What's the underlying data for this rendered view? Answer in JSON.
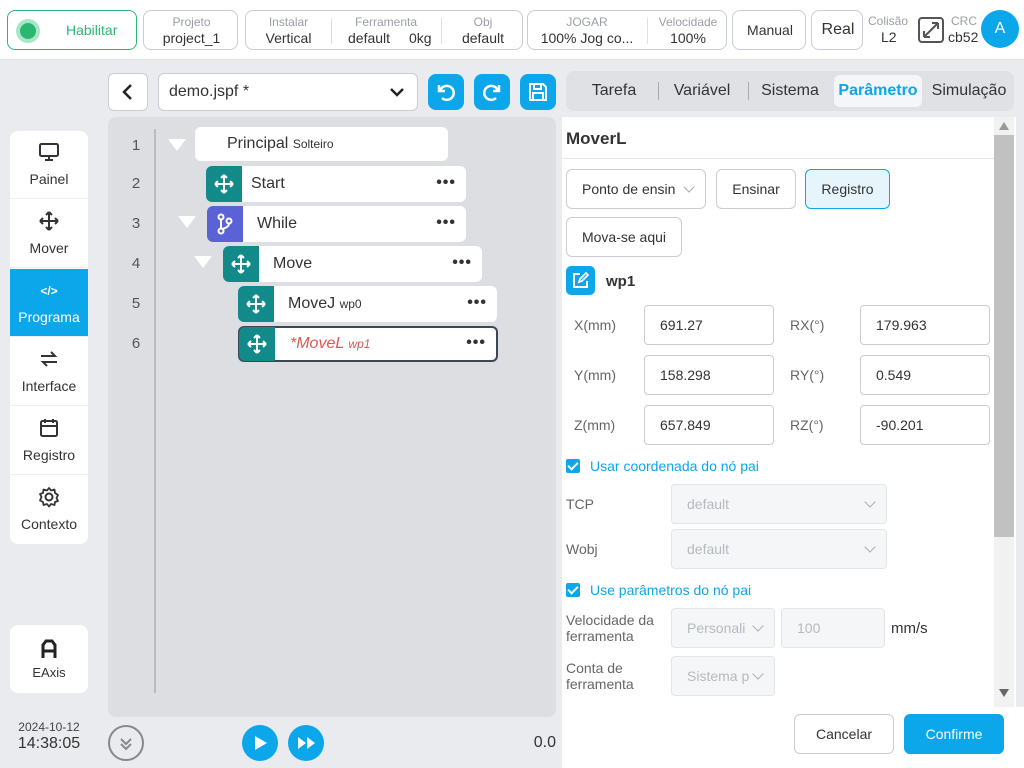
{
  "topbar": {
    "enable_label": "Habilitar",
    "project": {
      "label": "Projeto",
      "value": "project_1"
    },
    "install": {
      "label": "Instalar",
      "value": "Vertical"
    },
    "tool": {
      "label": "Ferramenta",
      "value": "default",
      "weight": "0kg"
    },
    "obj": {
      "label": "Obj",
      "value": "default"
    },
    "play": {
      "label": "JOGAR",
      "value": "100%  Jog co..."
    },
    "speed": {
      "label": "Velocidade",
      "value": "100%"
    },
    "mode": "Manual",
    "real": "Real",
    "collision": {
      "label": "Colisão",
      "value": "L2"
    },
    "crc": {
      "label": "CRC",
      "value": "cb52"
    },
    "avatar": "A"
  },
  "sidebar": {
    "items": [
      {
        "label": "Painel",
        "icon": "monitor-icon"
      },
      {
        "label": "Mover",
        "icon": "move-icon"
      },
      {
        "label": "Programa",
        "icon": "code-icon",
        "icon_text": "</>"
      },
      {
        "label": "Interface",
        "icon": "swap-icon"
      },
      {
        "label": "Registro",
        "icon": "calendar-icon"
      },
      {
        "label": "Contexto",
        "icon": "gear-icon"
      }
    ],
    "eaxis": "EAxis",
    "date": "2024-10-12",
    "time": "14:38:05"
  },
  "program": {
    "filename": "demo.jspf *",
    "lines": [
      "1",
      "2",
      "3",
      "4",
      "5",
      "6"
    ],
    "nodes": {
      "principal": "Principal",
      "principal_sub": "Solteiro",
      "start": "Start",
      "while": "While",
      "move": "Move",
      "movej": "MoveJ",
      "movej_sub": "wp0",
      "movel": "*MoveL",
      "movel_sub": "wp1"
    },
    "dots": "•••",
    "progress_value": "0.0"
  },
  "tabs": [
    "Tarefa",
    "Variável",
    "Sistema",
    "Parâmetro",
    "Simulação"
  ],
  "params": {
    "title": "MoverL",
    "point_select": "Ponto de ensin",
    "teach": "Ensinar",
    "register": "Registro",
    "move_here": "Mova-se aqui",
    "wp_name": "wp1",
    "coords": {
      "x_label": "X(mm)",
      "x": "691.27",
      "y_label": "Y(mm)",
      "y": "158.298",
      "z_label": "Z(mm)",
      "z": "657.849",
      "rx_label": "RX(°)",
      "rx": "179.963",
      "ry_label": "RY(°)",
      "ry": "0.549",
      "rz_label": "RZ(°)",
      "rz": "-90.201"
    },
    "use_parent_coord": "Usar coordenada do nó pai",
    "tcp_label": "TCP",
    "tcp_value": "default",
    "wobj_label": "Wobj",
    "wobj_value": "default",
    "use_parent_params": "Use parâmetros do nó pai",
    "tool_speed_label": "Velocidade da ferramenta",
    "tool_speed_select": "Personali",
    "tool_speed_value": "100",
    "tool_speed_unit": "mm/s",
    "tool_count_label": "Conta de ferramenta",
    "tool_count_select": "Sistema p"
  },
  "footer": {
    "cancel": "Cancelar",
    "confirm": "Confirme"
  },
  "colors": {
    "accent": "#0ca6ea",
    "teal": "#128a8a",
    "purple": "#5b62d6",
    "enable_green": "#2bb673"
  }
}
